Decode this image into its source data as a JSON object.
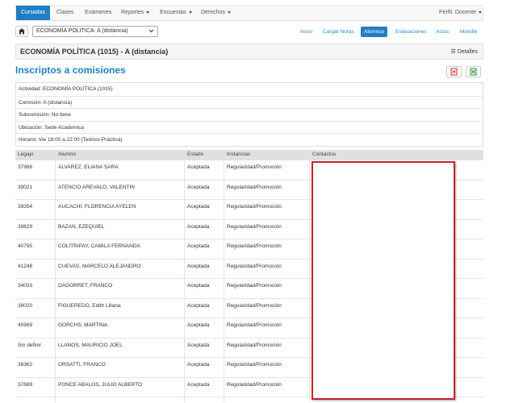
{
  "navbar": {
    "items": [
      {
        "label": "Cursadas",
        "active": true
      },
      {
        "label": "Clases"
      },
      {
        "label": "Exámenes"
      },
      {
        "label": "Reportes",
        "dropdown": true
      },
      {
        "label": "Encuestas",
        "dropdown": true
      },
      {
        "label": "Derechos",
        "dropdown": true
      }
    ],
    "profile": "Perfil: Docente"
  },
  "toolbar": {
    "course_select": "ECONOMÍA POLITICA: A (distancia)",
    "pills": [
      {
        "label": "Inicio"
      },
      {
        "label": "Cargar Notas"
      },
      {
        "label": "Alumnos",
        "active": true
      },
      {
        "label": "Evaluaciones"
      },
      {
        "label": "Actas"
      },
      {
        "label": "Moodle"
      }
    ]
  },
  "header": {
    "title": "ECONOMÍA POLÍTICA (1015) - A (distancia)",
    "details": "Detalles"
  },
  "section": {
    "title": "Inscriptos a comisiones"
  },
  "info": [
    "Actividad: ECONOMÍA POLÍTICA (1015)",
    "Comisión: A (distancia)",
    "Subcomisión: No tiene",
    "Ubicación: Sede Academica",
    "Horario: Vie 18:00 a 22:00 (Teórico-Práctica)"
  ],
  "table": {
    "headers": [
      "Legajo",
      "Alumno",
      "Estado",
      "Instancias",
      "Contactos"
    ],
    "rows": [
      {
        "legajo": "37966",
        "alumno": "ALVAREZ, ELIANA SARA",
        "estado": "Aceptada",
        "instancias": "Regularidad/Promoción"
      },
      {
        "legajo": "39021",
        "alumno": "ATENCIO AREVALO, VALENTIN",
        "estado": "Aceptada",
        "instancias": "Regularidad/Promoción"
      },
      {
        "legajo": "39354",
        "alumno": "AUCACHI, FLORENCIA AYELEN",
        "estado": "Aceptada",
        "instancias": "Regularidad/Promoción"
      },
      {
        "legajo": "39829",
        "alumno": "BAZAN, EZEQUIEL",
        "estado": "Aceptada",
        "instancias": "Regularidad/Promoción"
      },
      {
        "legajo": "40795",
        "alumno": "COLITRIPAY, CAMILA FERNANDA",
        "estado": "Aceptada",
        "instancias": "Regularidad/Promoción"
      },
      {
        "legajo": "41248",
        "alumno": "CUEVAS, MARCELO ALEJANDRO",
        "estado": "Aceptada",
        "instancias": "Regularidad/Promoción"
      },
      {
        "legajo": "34033",
        "alumno": "DAGORRET, FRANCO",
        "estado": "Aceptada",
        "instancias": "Regularidad/Promoción"
      },
      {
        "legajo": "38020",
        "alumno": "FIGUEREDO, Edith Liliana",
        "estado": "Aceptada",
        "instancias": "Regularidad/Promoción"
      },
      {
        "legajo": "40969",
        "alumno": "GORCHS, MARTINA",
        "estado": "Aceptada",
        "instancias": "Regularidad/Promoción"
      },
      {
        "legajo": "Sin definir",
        "alumno": "LLANOS, MAURICIO JOEL",
        "estado": "Aceptada",
        "instancias": "Regularidad/Promoción"
      },
      {
        "legajo": "38362",
        "alumno": "ORSATTI, FRANCO",
        "estado": "Aceptada",
        "instancias": "Regularidad/Promoción"
      },
      {
        "legajo": "37689",
        "alumno": "PONCE ABALOS, JULIO ALBERTO",
        "estado": "Aceptada",
        "instancias": "Regularidad/Promoción"
      }
    ]
  },
  "colors": {
    "primary": "#1f7ec2",
    "redaction_border": "#c9232b"
  }
}
